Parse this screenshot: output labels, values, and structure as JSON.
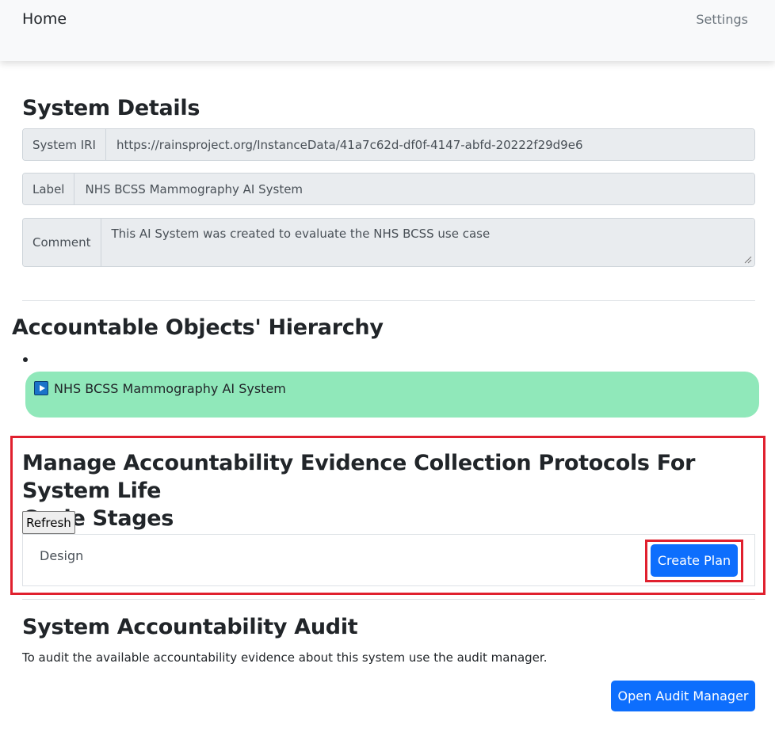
{
  "nav": {
    "home": "Home",
    "settings": "Settings"
  },
  "system_details": {
    "title": "System Details",
    "iri_label": "System IRI",
    "iri_value": "https://rainsproject.org/InstanceData/41a7c62d-df0f-4147-abfd-20222f29d9e6",
    "label_label": "Label",
    "label_value": "NHS BCSS Mammography AI System",
    "comment_label": "Comment",
    "comment_value": "This AI System was created to evaluate the NHS BCSS use case"
  },
  "hierarchy": {
    "title": "Accountable Objects' Hierarchy",
    "root_node": "NHS BCSS Mammography AI System",
    "node_icon": "play-icon"
  },
  "protocols": {
    "title_line1": "Manage Accountability Evidence Collection Protocols For System Life",
    "title_line2": "Cycle Stages",
    "refresh_label": "Refresh",
    "stages": [
      {
        "name": "Design",
        "action_label": "Create Plan"
      }
    ]
  },
  "audit": {
    "title": "System Accountability Audit",
    "description": "To audit the available accountability evidence about this system use the audit manager.",
    "button_label": "Open Audit Manager"
  },
  "colors": {
    "primary": "#0d6efd",
    "node_bg": "#90e8ba",
    "highlight": "#e0202e"
  }
}
